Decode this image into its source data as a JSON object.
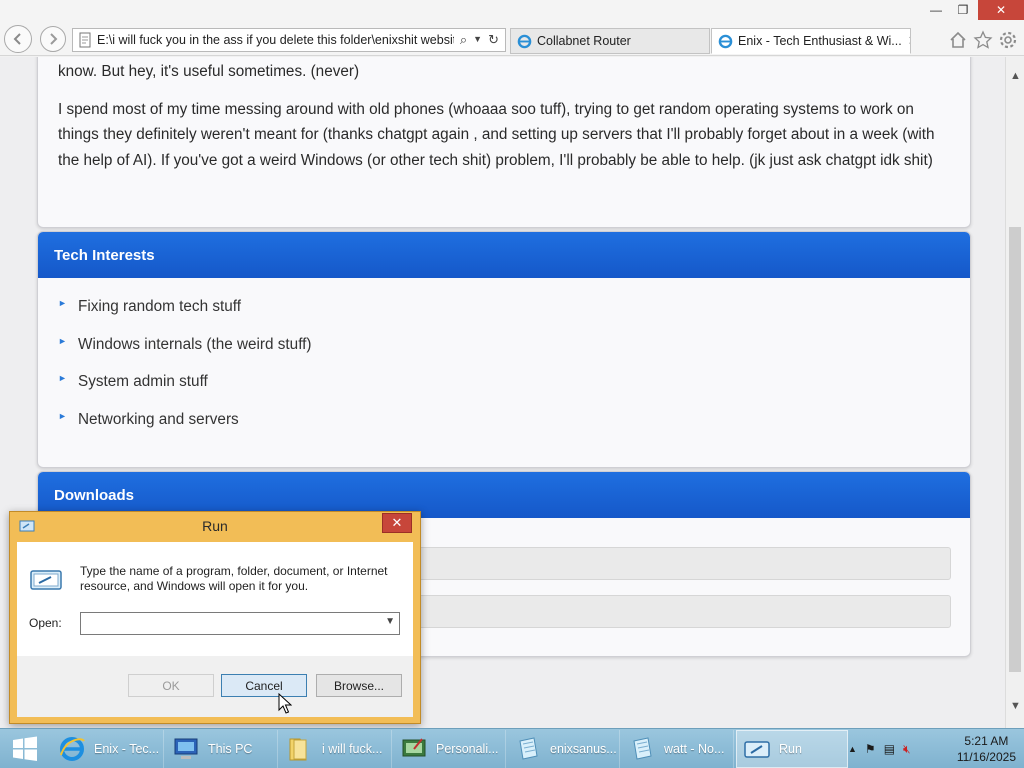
{
  "browser": {
    "address_url": "E:\\i will fuck you in the ass if you delete this folder\\enixshit website.",
    "tabs": [
      {
        "label": "Collabnet Router",
        "active": false
      },
      {
        "label": "Enix - Tech Enthusiast & Wi...",
        "active": true
      }
    ],
    "window_controls": {
      "minimize": "—",
      "restore": "❐",
      "close": "✕"
    }
  },
  "page": {
    "about": {
      "line_fragment": "know. But hey, it's useful sometimes. (never)",
      "paragraph": "I spend most of my time messing around with old phones (whoaaa soo tuff), trying to get random operating systems to work on things they definitely weren't meant for (thanks chatgpt again , and setting up servers that I'll probably forget about in a week (with the help of AI). If you've got a weird Windows (or other tech shit) problem, I'll probably be able to help. (jk just ask chatgpt idk shit)"
    },
    "tech_interests": {
      "heading": "Tech Interests",
      "items": [
        "Fixing random tech stuff",
        "Windows internals (the weird stuff)",
        "System admin stuff",
        "Networking and servers"
      ]
    },
    "downloads": {
      "heading": "Downloads"
    }
  },
  "run_dialog": {
    "title": "Run",
    "description": "Type the name of a program, folder, document, or Internet resource, and Windows will open it for you.",
    "open_label": "Open:",
    "open_value": "",
    "ok_label": "OK",
    "cancel_label": "Cancel",
    "browse_label": "Browse..."
  },
  "taskbar": {
    "items": [
      {
        "label": "Enix - Tec...",
        "icon": "ie-icon"
      },
      {
        "label": "This PC",
        "icon": "computer-icon"
      },
      {
        "label": "i will fuck...",
        "icon": "folder-icon"
      },
      {
        "label": "Personali...",
        "icon": "personalization-icon"
      },
      {
        "label": "enixsanus...",
        "icon": "notepad-icon"
      },
      {
        "label": "watt - No...",
        "icon": "notepad-icon"
      },
      {
        "label": "Run",
        "icon": "run-icon",
        "active": true
      }
    ],
    "clock_time": "5:21 AM",
    "clock_date": "11/16/2025"
  },
  "colors": {
    "accent_blue": "#1c66d6",
    "dialog_frame": "#f2bd56",
    "close_red": "#c7463a",
    "taskbar": "#8fbcd6"
  }
}
